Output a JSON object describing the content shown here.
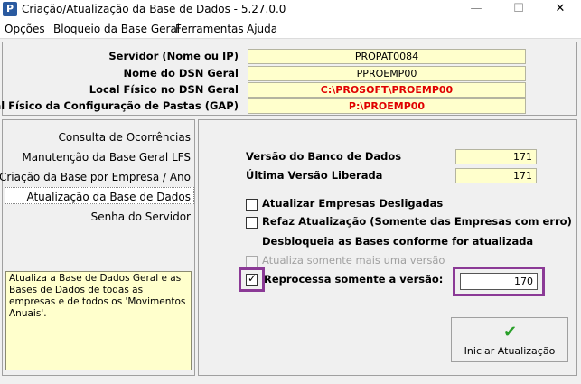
{
  "window": {
    "title": "Criação/Atualização da Base de Dados - 5.27.0.0",
    "app_icon_letter": "P",
    "minimize": "—",
    "maximize": "☐",
    "close": "✕"
  },
  "menu": [
    "Opções",
    "Bloqueio da Base Geral",
    "Ferramentas",
    "Ajuda"
  ],
  "server_info": {
    "server_label": "Servidor (Nome ou IP)",
    "server_value": "PROPAT0084",
    "dsn_label": "Nome do DSN Geral",
    "dsn_value": "PPROEMP00",
    "dsn_path_label": "Local Físico no DSN Geral",
    "dsn_path_value": "C:\\PROSOFT\\PROEMP00",
    "gap_label": "Local Físico da Configuração de Pastas (GAP)",
    "gap_value": "P:\\PROEMP00"
  },
  "nav": {
    "items": [
      "Consulta de Ocorrências",
      "Manutenção da Base Geral LFS",
      "Criação da Base por Empresa / Ano",
      "Atualização da Base de Dados",
      "Senha do Servidor"
    ],
    "description": "Atualiza a Base de Dados Geral e as Bases de Dados de todas as empresas e de todos os 'Movimentos Anuais'."
  },
  "main": {
    "db_version_label": "Versão do Banco de Dados",
    "db_version_value": "171",
    "last_release_label": "Última Versão Liberada",
    "last_release_value": "171",
    "opt_update_disconnected": "Atualizar Empresas Desligadas",
    "opt_redo_update": "Refaz Atualização (Somente das Empresas com erro)",
    "unlock_note": "Desbloqueia as Bases conforme for atualizada",
    "opt_update_once": "Atualiza somente mais uma versão",
    "opt_reprocess": "Reprocessa somente a versão:",
    "reprocess_version": "170",
    "start_button": "Iniciar Atualização",
    "check_glyph": "✓",
    "tick_glyph": "✔"
  },
  "colors": {
    "field_bg": "#ffffcc",
    "path_text": "#e00000",
    "highlight": "#8b3a96",
    "start_icon": "#2aa02a"
  }
}
